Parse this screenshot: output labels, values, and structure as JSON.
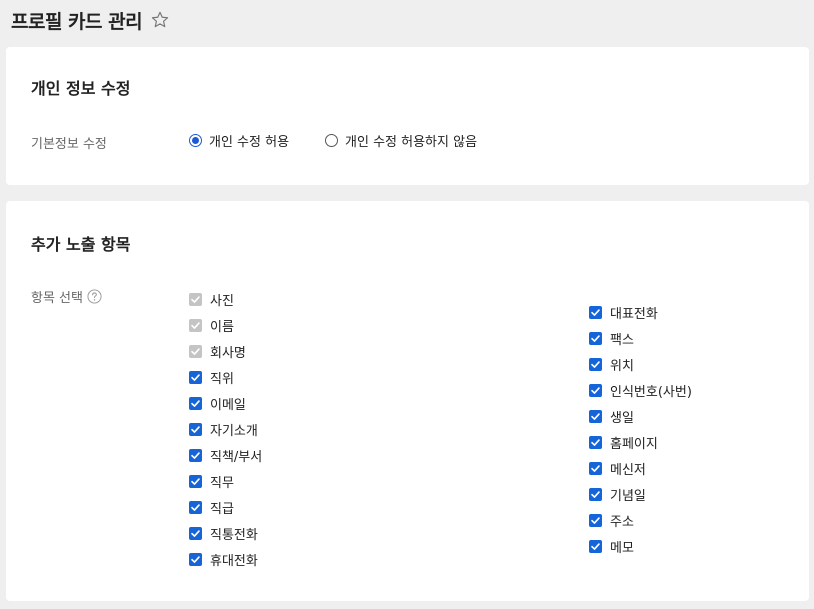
{
  "page": {
    "title": "프로필 카드 관리"
  },
  "personal_section": {
    "title": "개인 정보 수정",
    "label": "기본정보 수정",
    "options": [
      {
        "label": "개인 수정 허용",
        "selected": true
      },
      {
        "label": "개인 수정 허용하지 않음",
        "selected": false
      }
    ]
  },
  "exposure_section": {
    "title": "추가 노출 항목",
    "label": "항목 선택",
    "left_items": [
      {
        "label": "사진",
        "checked": true,
        "disabled": true
      },
      {
        "label": "이름",
        "checked": true,
        "disabled": true
      },
      {
        "label": "회사명",
        "checked": true,
        "disabled": true
      },
      {
        "label": "직위",
        "checked": true,
        "disabled": false
      },
      {
        "label": "이메일",
        "checked": true,
        "disabled": false
      },
      {
        "label": "자기소개",
        "checked": true,
        "disabled": false
      },
      {
        "label": "직책/부서",
        "checked": true,
        "disabled": false
      },
      {
        "label": "직무",
        "checked": true,
        "disabled": false
      },
      {
        "label": "직급",
        "checked": true,
        "disabled": false
      },
      {
        "label": "직통전화",
        "checked": true,
        "disabled": false
      },
      {
        "label": "휴대전화",
        "checked": true,
        "disabled": false
      }
    ],
    "right_items": [
      {
        "label": "대표전화",
        "checked": true,
        "disabled": false
      },
      {
        "label": "팩스",
        "checked": true,
        "disabled": false
      },
      {
        "label": "위치",
        "checked": true,
        "disabled": false
      },
      {
        "label": "인식번호(사번)",
        "checked": true,
        "disabled": false
      },
      {
        "label": "생일",
        "checked": true,
        "disabled": false
      },
      {
        "label": "홈페이지",
        "checked": true,
        "disabled": false
      },
      {
        "label": "메신저",
        "checked": true,
        "disabled": false
      },
      {
        "label": "기념일",
        "checked": true,
        "disabled": false
      },
      {
        "label": "주소",
        "checked": true,
        "disabled": false
      },
      {
        "label": "메모",
        "checked": true,
        "disabled": false
      }
    ]
  },
  "colors": {
    "accent": "#1565d8",
    "disabled": "#c4c4c4",
    "background": "#efefef"
  },
  "icons": {
    "favorite": "star-outline-icon",
    "help": "question-circle-icon",
    "check": "checkmark-icon"
  }
}
